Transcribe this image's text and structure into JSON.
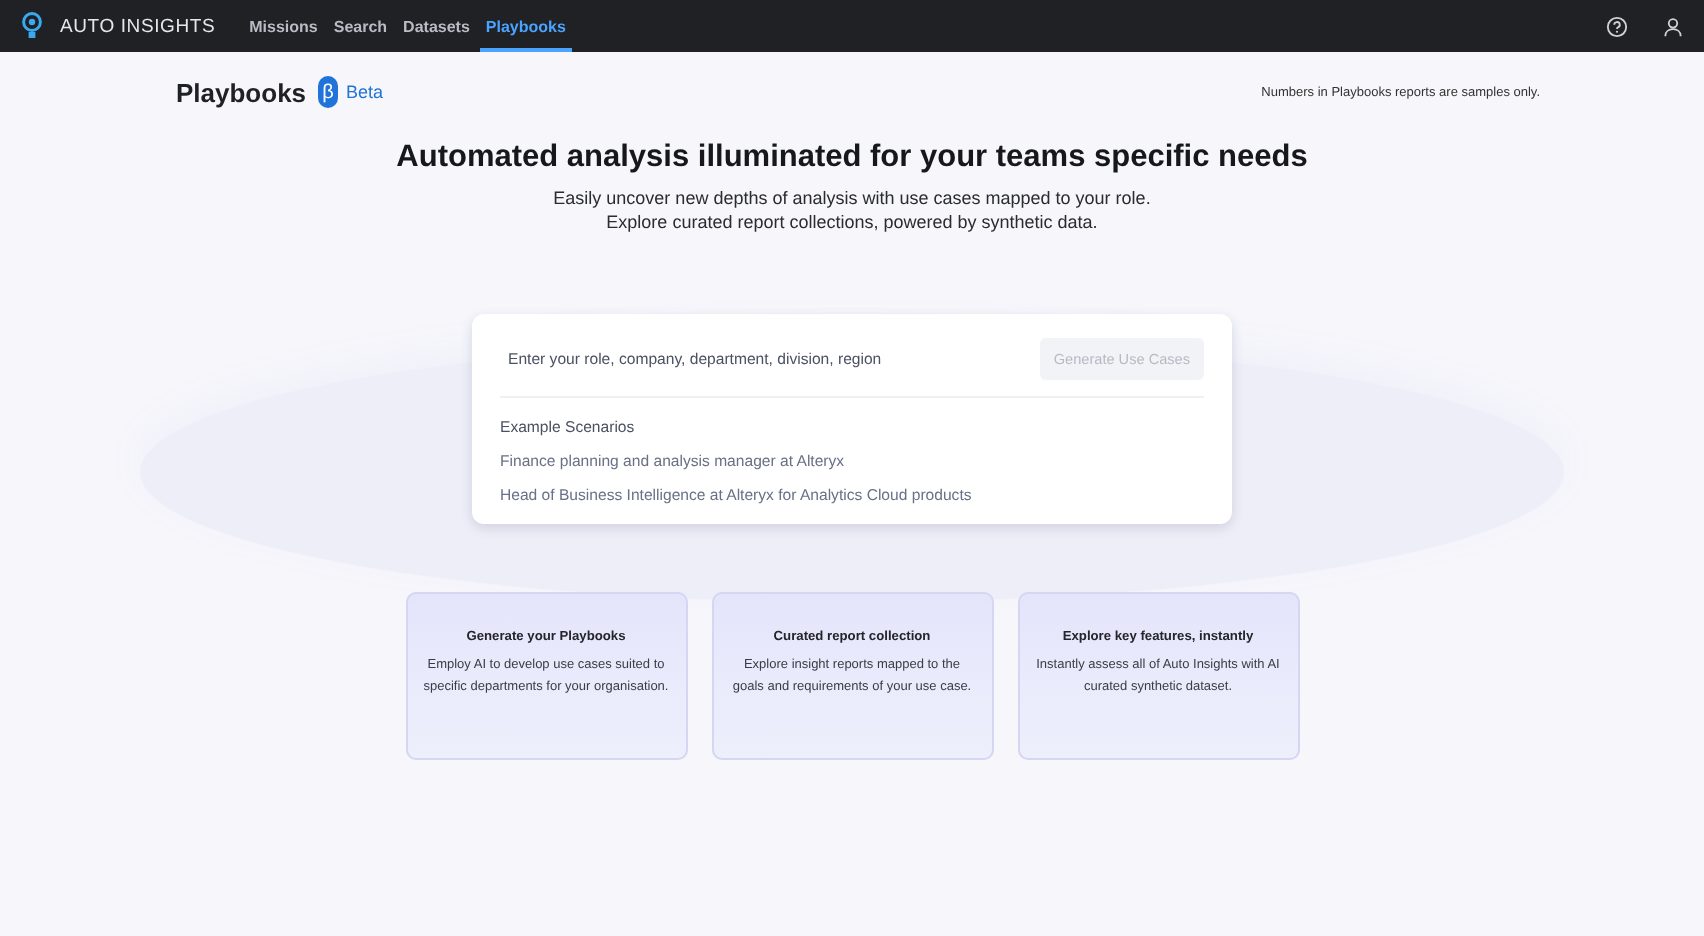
{
  "nav": {
    "brand": "AUTO INSIGHTS",
    "tabs": [
      {
        "label": "Missions",
        "selected": false
      },
      {
        "label": "Search",
        "selected": false
      },
      {
        "label": "Datasets",
        "selected": false
      },
      {
        "label": "Playbooks",
        "selected": true
      }
    ]
  },
  "header": {
    "title": "Playbooks",
    "badge_symbol": "β",
    "badge_label": "Beta",
    "note": "Numbers in Playbooks reports are samples only."
  },
  "hero": {
    "heading": "Automated analysis illuminated for your teams specific needs",
    "lines": [
      "Easily uncover new depths of analysis with use cases mapped to your role.",
      "Explore curated report collections, powered by synthetic data."
    ]
  },
  "search": {
    "placeholder": "Enter your role, company, department, division, region",
    "button": {
      "label": "Generate Use Cases",
      "disabled": true
    },
    "examples_title": "Example Scenarios",
    "examples": [
      "Finance planning and analysis manager at Alteryx",
      "Head of Business Intelligence at Alteryx for Analytics Cloud products"
    ]
  },
  "features": [
    {
      "title": "Generate your Playbooks",
      "text": "Employ AI to develop use cases suited to specific departments for your organisation."
    },
    {
      "title": "Curated report collection",
      "text": "Explore insight reports mapped to the goals and requirements of your use case."
    },
    {
      "title": "Explore key features, instantly",
      "text": "Instantly assess all of Auto Insights with AI curated synthetic dataset."
    }
  ]
}
